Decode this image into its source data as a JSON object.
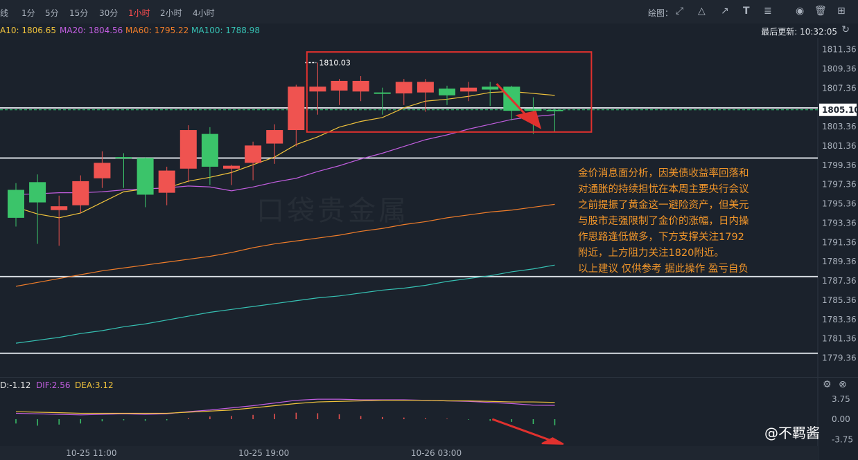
{
  "toolbar": {
    "timeframes": [
      "线",
      "1分",
      "5分",
      "15分",
      "30分",
      "1小时",
      "2小时",
      "4小时"
    ],
    "active_timeframe": "1小时",
    "draw_label": "绘图：",
    "icons": [
      "line-tool-icon",
      "triangle-tool-icon",
      "arrow-tool-icon",
      "text-tool-icon",
      "fib-tool-icon",
      "eye-icon",
      "trash-icon",
      "layout-icon"
    ]
  },
  "ma_legend": [
    {
      "label": "A10: 1806.65",
      "color": "#f0c33c"
    },
    {
      "label": "MA20: 1804.56",
      "color": "#c25ee0"
    },
    {
      "label": "MA60: 1795.22",
      "color": "#f07d2a"
    },
    {
      "label": "MA100: 1788.98",
      "color": "#36c2b4"
    }
  ],
  "last_update": "最后更新: 10:32:05",
  "macd_legend": [
    {
      "label": "D:-1.12",
      "color": "#e8e8e8"
    },
    {
      "label": "DIF:2.56",
      "color": "#c25ee0"
    },
    {
      "label": "DEA:3.12",
      "color": "#f0c33c"
    }
  ],
  "note": "金价消息面分析，因美债收益率回落和\n对通胀的持续担忧在本周主要央行会议\n之前提振了黄金这一避险资产，但美元\n与股市走强限制了金价的涨幅，日内操\n作思路逢低做多，下方支撑关注1792\n附近，上方阻力关注1820附近。\n以上建议 仅供参考 据此操作 盈亏自负",
  "watermark_author": "@不羁酱",
  "watermark_logo": "口袋贵金属",
  "chart_data": {
    "type": "candlestick",
    "y_ticks": [
      "1811.36",
      "1809.36",
      "1807.36",
      "1805.36",
      "1803.36",
      "1801.36",
      "1799.36",
      "1797.36",
      "1795.36",
      "1793.36",
      "1791.36",
      "1789.36",
      "1787.36",
      "1785.36",
      "1783.36",
      "1781.36",
      "1779.36"
    ],
    "ylim": [
      1778.5,
      1812.0
    ],
    "x_ticks": [
      {
        "label": "10-25 11:00",
        "index": 3.5
      },
      {
        "label": "10-25 19:00",
        "index": 11.5
      },
      {
        "label": "10-26 03:00",
        "index": 19.5
      }
    ],
    "current_price": "1805.10",
    "high_label": "1810.03",
    "horizontal_levels": [
      1805.3,
      1800.1,
      1787.8,
      1779.85
    ],
    "box_range": {
      "start_index": 13.5,
      "end_index": 26.7,
      "top": 1811.1,
      "bottom": 1802.8
    },
    "candles": [
      {
        "o": 1796.8,
        "h": 1797.5,
        "c": 1793.9,
        "l": 1793.0
      },
      {
        "o": 1797.6,
        "h": 1798.4,
        "c": 1795.5,
        "l": 1791.2
      },
      {
        "o": 1794.7,
        "h": 1796.2,
        "c": 1795.1,
        "l": 1791.0
      },
      {
        "o": 1795.2,
        "h": 1798.3,
        "c": 1797.7,
        "l": 1794.4
      },
      {
        "o": 1798.0,
        "h": 1800.8,
        "c": 1799.6,
        "l": 1797.0
      },
      {
        "o": 1800.2,
        "h": 1800.6,
        "c": 1800.1,
        "l": 1797.0
      },
      {
        "o": 1800.1,
        "h": 1800.2,
        "c": 1796.3,
        "l": 1795.0
      },
      {
        "o": 1796.5,
        "h": 1799.2,
        "c": 1798.8,
        "l": 1795.2
      },
      {
        "o": 1799.0,
        "h": 1803.5,
        "c": 1803.0,
        "l": 1797.6
      },
      {
        "o": 1802.6,
        "h": 1803.3,
        "c": 1799.2,
        "l": 1797.3
      },
      {
        "o": 1799.0,
        "h": 1799.4,
        "c": 1799.3,
        "l": 1797.3
      },
      {
        "o": 1799.6,
        "h": 1801.8,
        "c": 1801.4,
        "l": 1797.8
      },
      {
        "o": 1801.6,
        "h": 1803.6,
        "c": 1803.0,
        "l": 1799.5
      },
      {
        "o": 1803.0,
        "h": 1807.7,
        "c": 1807.5,
        "l": 1801.3
      },
      {
        "o": 1807.0,
        "h": 1810.0,
        "c": 1807.5,
        "l": 1804.6
      },
      {
        "o": 1807.1,
        "h": 1808.3,
        "c": 1808.1,
        "l": 1805.6
      },
      {
        "o": 1807.0,
        "h": 1808.6,
        "c": 1808.1,
        "l": 1806.0
      },
      {
        "o": 1806.9,
        "h": 1807.4,
        "c": 1806.8,
        "l": 1804.6
      },
      {
        "o": 1806.8,
        "h": 1808.3,
        "c": 1808.0,
        "l": 1805.6
      },
      {
        "o": 1806.9,
        "h": 1808.3,
        "c": 1808.0,
        "l": 1804.9
      },
      {
        "o": 1807.3,
        "h": 1807.6,
        "c": 1806.6,
        "l": 1805.6
      },
      {
        "o": 1807.0,
        "h": 1808.0,
        "c": 1807.4,
        "l": 1806.0
      },
      {
        "o": 1807.5,
        "h": 1808.0,
        "c": 1807.2,
        "l": 1805.5
      },
      {
        "o": 1807.5,
        "h": 1807.6,
        "c": 1805.0,
        "l": 1804.0
      },
      {
        "o": 1805.2,
        "h": 1806.4,
        "c": 1805.0,
        "l": 1802.6
      },
      {
        "o": 1805.1,
        "h": 1805.2,
        "c": 1805.0,
        "l": 1802.8
      }
    ],
    "series": [
      {
        "name": "MA10",
        "color": "#f0c33c",
        "values": [
          1795.0,
          1794.3,
          1793.9,
          1794.4,
          1795.5,
          1796.6,
          1796.9,
          1797.0,
          1797.7,
          1798.1,
          1798.6,
          1799.4,
          1800.2,
          1801.5,
          1802.3,
          1803.3,
          1803.9,
          1804.3,
          1805.3,
          1806.0,
          1806.2,
          1806.5,
          1806.9,
          1807.0,
          1806.8,
          1806.6
        ]
      },
      {
        "name": "MA20",
        "color": "#c25ee0",
        "values": [
          1796.3,
          1796.4,
          1796.5,
          1796.5,
          1796.6,
          1796.8,
          1796.9,
          1797.0,
          1797.2,
          1797.1,
          1796.7,
          1797.1,
          1797.6,
          1798.0,
          1798.7,
          1799.3,
          1800.0,
          1800.6,
          1801.3,
          1802.0,
          1802.5,
          1803.1,
          1803.6,
          1804.1,
          1804.4,
          1804.6
        ]
      },
      {
        "name": "MA60",
        "color": "#f07d2a",
        "values": [
          1786.8,
          1787.2,
          1787.6,
          1788.0,
          1788.4,
          1788.7,
          1789.0,
          1789.3,
          1789.6,
          1789.9,
          1790.3,
          1790.8,
          1791.2,
          1791.5,
          1791.8,
          1792.1,
          1792.5,
          1792.8,
          1793.2,
          1793.5,
          1793.9,
          1794.2,
          1794.5,
          1794.7,
          1795.0,
          1795.3
        ]
      },
      {
        "name": "MA100",
        "color": "#36c2b4",
        "values": [
          1780.9,
          1781.2,
          1781.5,
          1781.9,
          1782.2,
          1782.6,
          1782.9,
          1783.3,
          1783.7,
          1784.1,
          1784.4,
          1784.7,
          1785.0,
          1785.3,
          1785.6,
          1785.8,
          1786.1,
          1786.4,
          1786.6,
          1786.9,
          1787.3,
          1787.6,
          1787.9,
          1788.3,
          1788.6,
          1789.0
        ]
      }
    ],
    "macd": {
      "y_ticks": [
        "3.75",
        "0.00",
        "-3.75"
      ],
      "ylim": [
        -5.0,
        5.0
      ],
      "dif": [
        1.1,
        1.0,
        0.9,
        0.8,
        0.9,
        1.0,
        0.9,
        1.0,
        1.4,
        1.7,
        2.1,
        2.5,
        3.0,
        3.5,
        3.7,
        3.7,
        3.6,
        3.6,
        3.6,
        3.5,
        3.4,
        3.3,
        3.1,
        2.9,
        2.6,
        2.56
      ],
      "dea": [
        1.4,
        1.3,
        1.2,
        1.1,
        1.1,
        1.1,
        1.1,
        1.1,
        1.3,
        1.5,
        1.7,
        2.1,
        2.5,
        2.9,
        3.2,
        3.3,
        3.4,
        3.5,
        3.5,
        3.5,
        3.4,
        3.4,
        3.3,
        3.2,
        3.2,
        3.12
      ],
      "hist": [
        -0.8,
        -1.2,
        -1.0,
        -0.8,
        -0.4,
        -0.2,
        -0.3,
        -0.2,
        0.2,
        0.5,
        0.6,
        0.8,
        1.0,
        1.2,
        1.1,
        0.9,
        0.6,
        0.4,
        0.3,
        0.2,
        0.1,
        -0.1,
        -0.3,
        -0.5,
        -0.9,
        -1.12
      ]
    }
  }
}
